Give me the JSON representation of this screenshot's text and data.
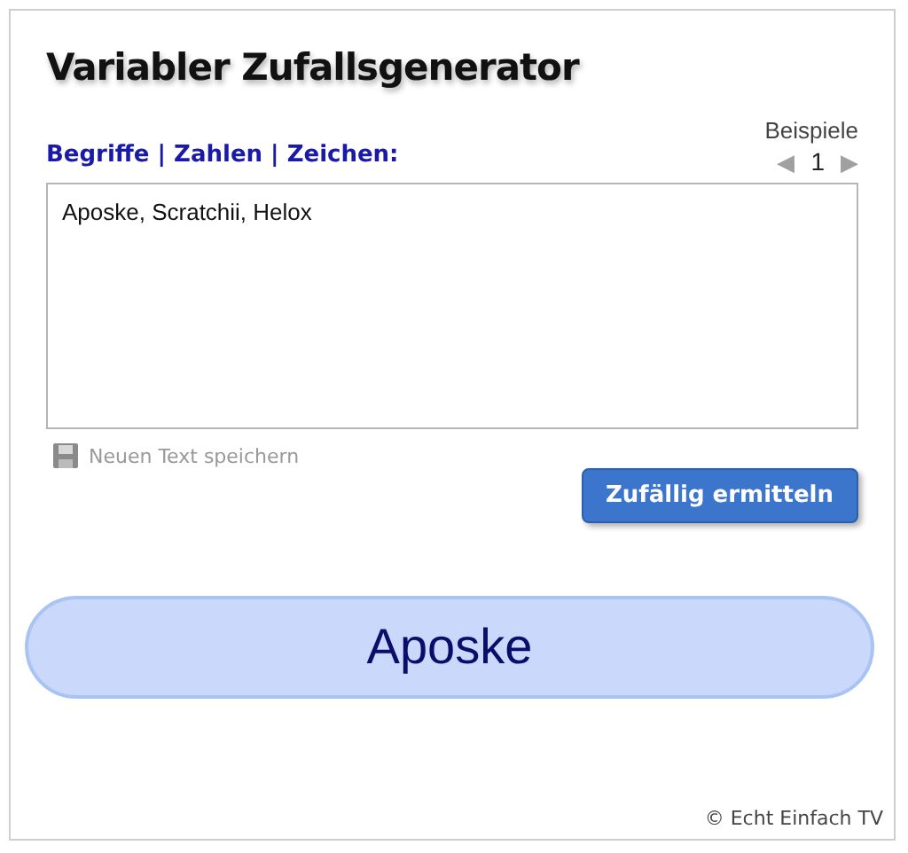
{
  "title": "Variabler Zufallsgenerator",
  "input_label": "Begriffe | Zahlen | Zeichen:",
  "examples": {
    "label": "Beispiele",
    "prev": "◀",
    "page": "1",
    "next": "▶"
  },
  "textarea": {
    "value": "Aposke, Scratchii, Helox"
  },
  "save_link": "Neuen Text speichern",
  "button": "Zufällig ermitteln",
  "result": "Aposke",
  "copyright": "© Echt Einfach TV"
}
